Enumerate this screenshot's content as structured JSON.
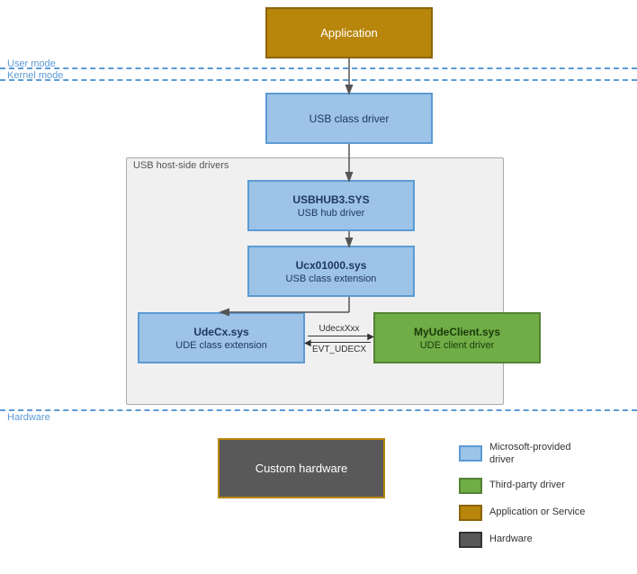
{
  "diagram": {
    "app_box": {
      "label": "Application"
    },
    "user_mode": {
      "label": "User mode"
    },
    "kernel_mode": {
      "label": "Kernel mode"
    },
    "usb_class_driver": {
      "label": "USB class driver"
    },
    "host_side": {
      "label": "USB host-side drivers"
    },
    "usbhub": {
      "title": "USBHUB3.SYS",
      "subtitle": "USB hub driver"
    },
    "ucx": {
      "title": "Ucx01000.sys",
      "subtitle": "USB class extension"
    },
    "udecx": {
      "title": "UdeCx.sys",
      "subtitle": "UDE class extension"
    },
    "myude": {
      "title": "MyUdeClient.sys",
      "subtitle": "UDE client driver"
    },
    "arrow_top": "UdecxXxx",
    "arrow_bottom": "EVT_UDECX",
    "hardware_label": "Hardware",
    "custom_hw": {
      "label": "Custom hardware"
    }
  },
  "legend": {
    "items": [
      {
        "color": "#9dc3e6",
        "border": "#5b9bd5",
        "label": "Microsoft-provided\ndriver"
      },
      {
        "color": "#70ad47",
        "border": "#548235",
        "label": "Third-party driver"
      },
      {
        "color": "#b8860b",
        "border": "#8b6508",
        "label": "Application or Service"
      },
      {
        "color": "#595959",
        "border": "#333",
        "label": "Hardware"
      }
    ]
  }
}
